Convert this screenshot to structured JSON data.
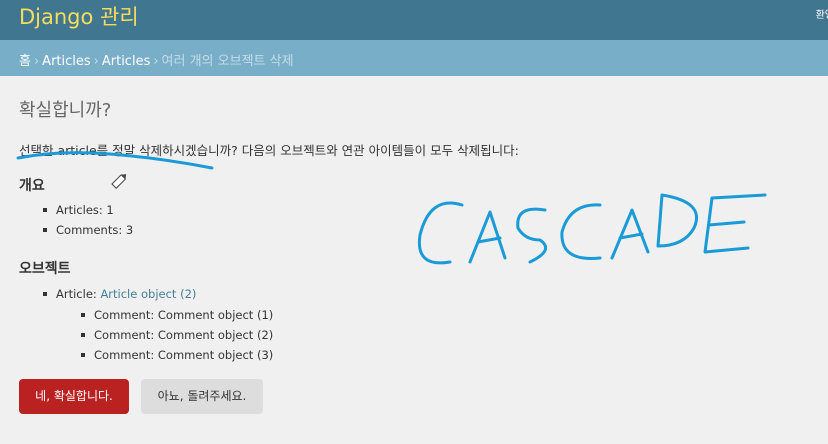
{
  "header": {
    "branding": "Django 관리",
    "user_tools": "환영"
  },
  "breadcrumbs": {
    "home": "홈",
    "app": "Articles",
    "model": "Articles",
    "current": "여러 개의 오브젝트 삭제",
    "separator": "›"
  },
  "content": {
    "title": "확실합니까?",
    "question": "선택한 article를 정말 삭제하시겠습니까? 다음의 오브젝트와 연관 아이템들이 모두 삭제됩니다:",
    "summary_heading": "개요",
    "summary_items": [
      "Articles: 1",
      "Comments: 3"
    ],
    "objects_heading": "오브젝트",
    "article_label": "Article: ",
    "article_link": "Article object (2)",
    "comment_items": [
      "Comment: Comment object (1)",
      "Comment: Comment object (2)",
      "Comment: Comment object (3)"
    ]
  },
  "buttons": {
    "confirm": "네, 확실합니다.",
    "cancel": "아뇨, 돌려주세요."
  },
  "annotation": {
    "handwriting": "CASCADE",
    "ink_color": "#1a9bd7"
  },
  "colors": {
    "header_bg": "#417690",
    "breadcrumbs_bg": "#79aec8",
    "branding": "#f5dd5d",
    "delete_button": "#ba2121",
    "cancel_button": "#dddddd",
    "link": "#447e9b"
  }
}
